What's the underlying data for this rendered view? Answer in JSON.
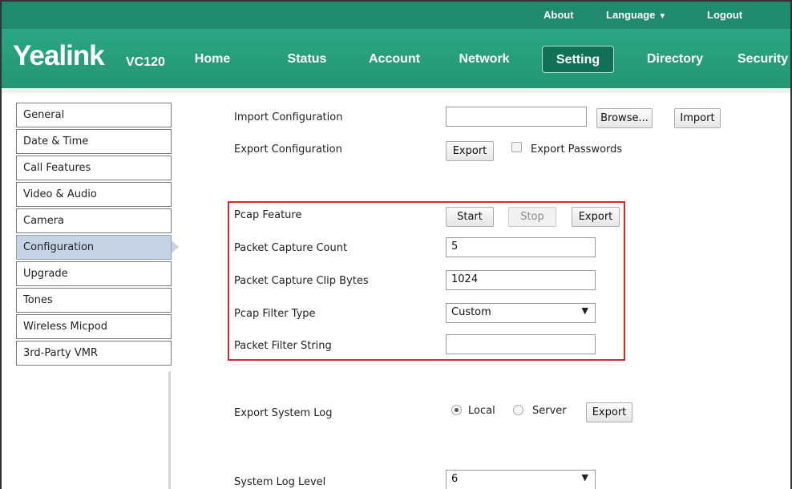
{
  "top_links": {
    "about": "About",
    "language": "Language",
    "logout": "Logout"
  },
  "brand": {
    "logo": "Yealink",
    "model": "VC120"
  },
  "nav": [
    "Home",
    "Status",
    "Account",
    "Network",
    "Setting",
    "Directory",
    "Security"
  ],
  "nav_active": "Setting",
  "sidebar": {
    "items": [
      "General",
      "Date & Time",
      "Call Features",
      "Video & Audio",
      "Camera",
      "Configuration",
      "Upgrade",
      "Tones",
      "Wireless Micpod",
      "3rd-Party VMR"
    ],
    "active": "Configuration"
  },
  "import_config": {
    "label": "Import Configuration",
    "value": "",
    "browse": "Browse...",
    "import": "Import"
  },
  "export_config": {
    "label": "Export Configuration",
    "export": "Export",
    "export_passwords_label": "Export Passwords",
    "export_passwords_checked": false
  },
  "pcap": {
    "feature_label": "Pcap Feature",
    "start": "Start",
    "stop": "Stop",
    "export": "Export",
    "count_label": "Packet Capture Count",
    "count_value": "5",
    "clip_label": "Packet Capture Clip Bytes",
    "clip_value": "1024",
    "filter_type_label": "Pcap Filter Type",
    "filter_type_value": "Custom",
    "filter_string_label": "Packet Filter String",
    "filter_string_value": ""
  },
  "system_log": {
    "label": "Export System Log",
    "local": "Local",
    "server": "Server",
    "selected": "Local",
    "export": "Export",
    "level_label": "System Log Level",
    "level_value": "6"
  },
  "colors": {
    "brand_green": "#239673",
    "highlight_red": "#e0242a",
    "active_sidebar": "#c6d3e4"
  }
}
